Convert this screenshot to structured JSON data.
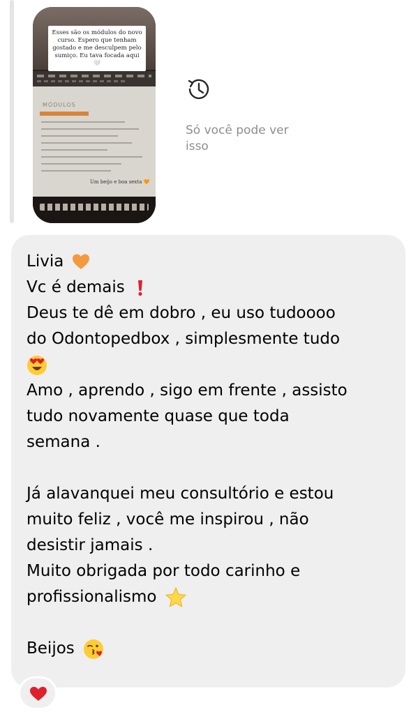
{
  "story": {
    "caption": "Esses são os módulos do novo curso. Espero que tenham gostado e me desculpem pelo sumiço. Eu tava focada aqui 🤍",
    "doc_title": "MÓDULOS",
    "signoff": "Um beijo e boa sexta 🧡"
  },
  "visibility": {
    "note": "Só você pode ver isso",
    "icon": "history-icon"
  },
  "message": {
    "lines": [
      "Livia",
      "Vc é demais",
      "Deus te dê em dobro , eu uso tudoooo",
      "do Odontopedbox , simplesmente tudo",
      "",
      "Amo , aprendo , sigo em frente , assisto",
      "tudo novamente quase que toda",
      "semana .",
      "",
      "Já alavanquei meu consultório e estou",
      "muito feliz , você me inspirou , não",
      "desistir jamais .",
      "Muito obrigada por todo carinho e",
      "profissionalismo",
      "",
      "Beijos"
    ],
    "emojis": [
      "orange-heart",
      "exclamation-mark",
      "heart-eyes-face",
      "star",
      "kissing-face"
    ]
  },
  "reaction": {
    "icon": "red-heart",
    "color": "#e0202c"
  },
  "colors": {
    "bubble": "#efefef",
    "muted_text": "#8e8e8e",
    "reply_bar": "#e4e4e4"
  }
}
